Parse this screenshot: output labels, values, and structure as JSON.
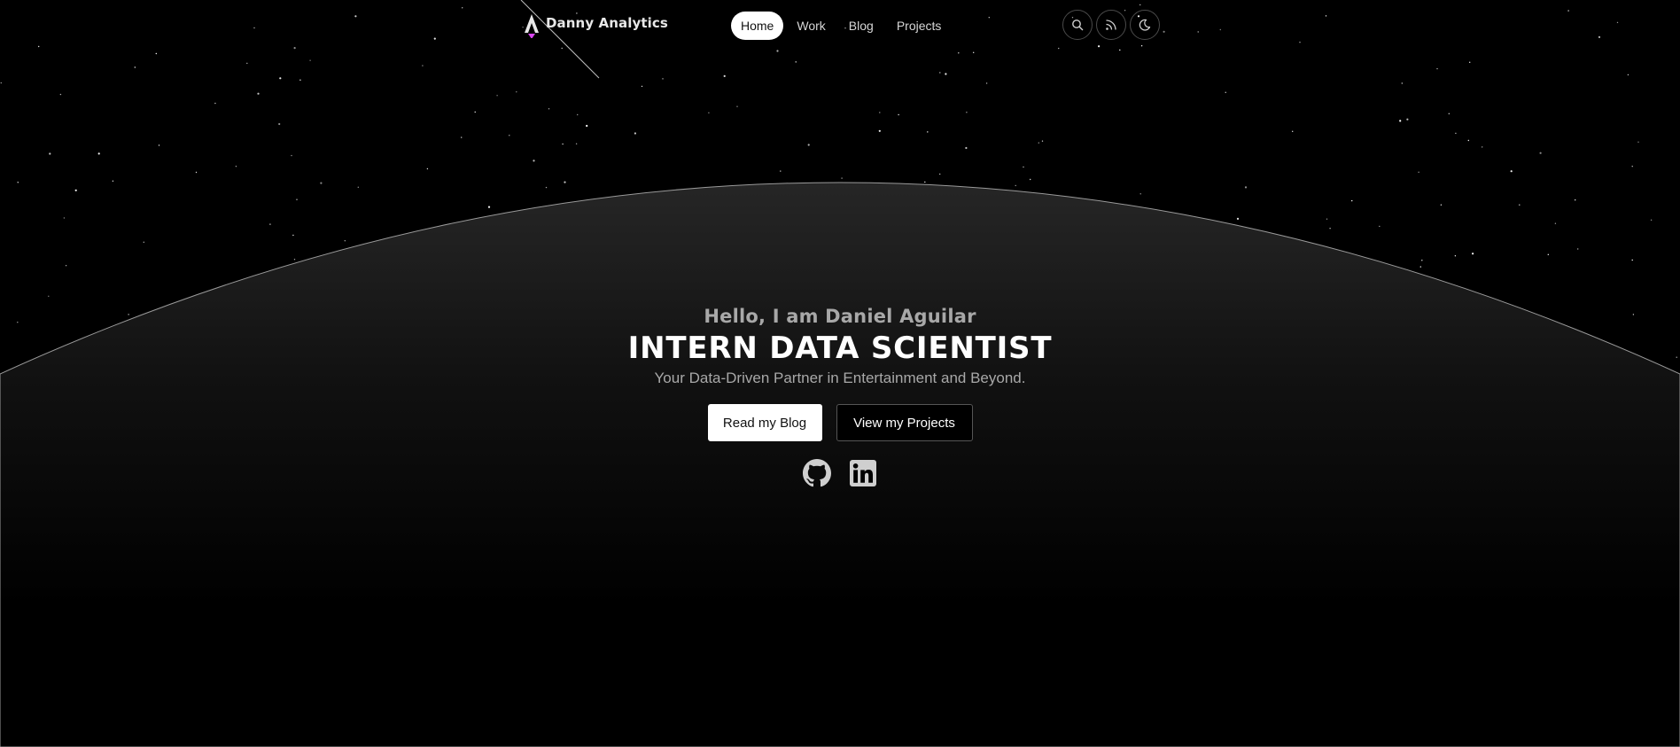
{
  "brand": {
    "name": "Danny Analytics",
    "logo_icon": "rocket-a-logo-icon",
    "accent_color": "#d946ef"
  },
  "nav": {
    "links": [
      {
        "label": "Home",
        "active": true
      },
      {
        "label": "Work",
        "active": false
      },
      {
        "label": "Blog",
        "active": false
      },
      {
        "label": "Projects",
        "active": false
      }
    ],
    "icons": [
      "search-icon",
      "rss-icon",
      "moon-icon"
    ]
  },
  "hero": {
    "greeting": "Hello, I am Daniel Aguilar",
    "title": "INTERN DATA SCIENTIST",
    "subtitle": "Your Data-Driven Partner in Entertainment and Beyond.",
    "primary_button": "Read my Blog",
    "secondary_button": "View my Projects",
    "socials": [
      "github-icon",
      "linkedin-icon"
    ]
  },
  "colors": {
    "background": "#000000",
    "planet_top": "#262626",
    "text_muted": "#a8a8a8"
  }
}
